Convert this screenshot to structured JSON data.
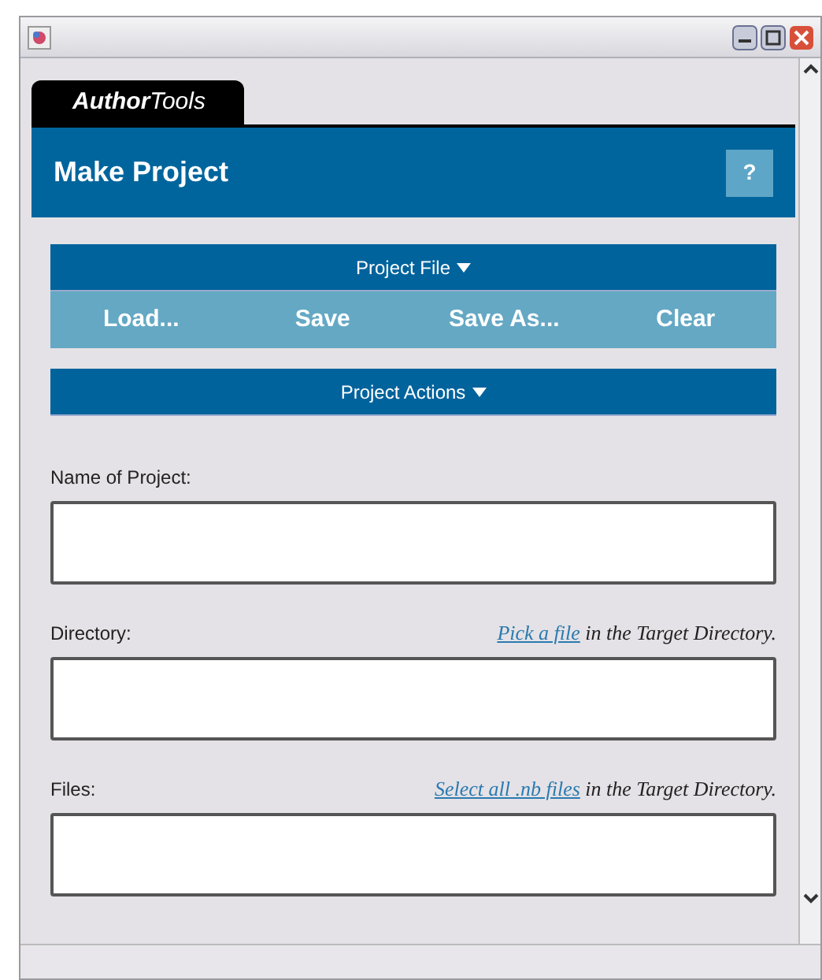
{
  "tab": {
    "label": "**Author**Tools",
    "selected": true
  },
  "header": {
    "title": "Make Project",
    "help": "?"
  },
  "project_file": {
    "label": "Project File",
    "expanded": true,
    "buttons": [
      "Load...",
      "Save",
      "Save As...",
      "Clear"
    ]
  },
  "project_actions": {
    "label": "Project Actions"
  },
  "fields": [
    {
      "label": "Name of Project:"
    },
    {
      "label": "Directory:",
      "hint_link": "Pick a file",
      "hint_text": " in the Target Directory."
    },
    {
      "label": "Files:",
      "hint_link": "Select all .nb files",
      "hint_text": " in the Target Directory."
    }
  ]
}
